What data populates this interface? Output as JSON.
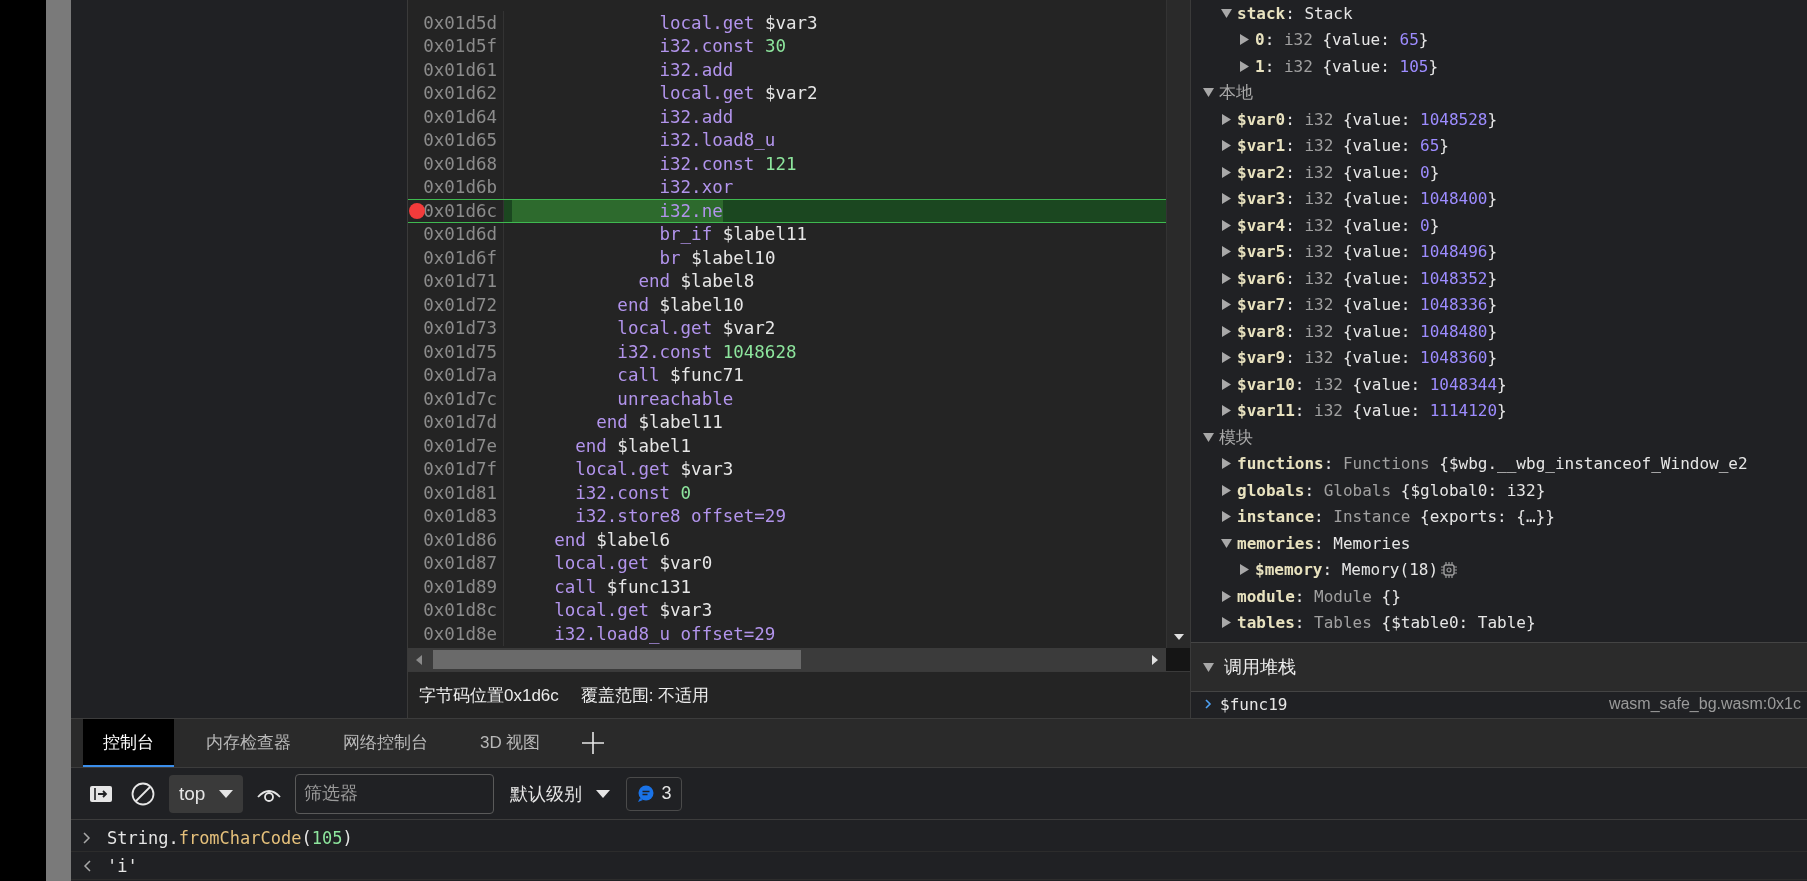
{
  "code_view": {
    "lines": [
      {
        "address": "0x01d5d",
        "breakpoint": false,
        "current": false,
        "segments": [
          {
            "text": "              local.get ",
            "kind": "op"
          },
          {
            "text": "$var3",
            "kind": "name"
          }
        ]
      },
      {
        "address": "0x01d5f",
        "breakpoint": false,
        "current": false,
        "segments": [
          {
            "text": "              i32.const ",
            "kind": "op"
          },
          {
            "text": "30",
            "kind": "literal"
          }
        ]
      },
      {
        "address": "0x01d61",
        "breakpoint": false,
        "current": false,
        "segments": [
          {
            "text": "              i32.add",
            "kind": "op"
          }
        ]
      },
      {
        "address": "0x01d62",
        "breakpoint": false,
        "current": false,
        "segments": [
          {
            "text": "              local.get ",
            "kind": "op"
          },
          {
            "text": "$var2",
            "kind": "name"
          }
        ]
      },
      {
        "address": "0x01d64",
        "breakpoint": false,
        "current": false,
        "segments": [
          {
            "text": "              i32.add",
            "kind": "op"
          }
        ]
      },
      {
        "address": "0x01d65",
        "breakpoint": false,
        "current": false,
        "segments": [
          {
            "text": "              i32.load8_u",
            "kind": "op"
          }
        ]
      },
      {
        "address": "0x01d68",
        "breakpoint": false,
        "current": false,
        "segments": [
          {
            "text": "              i32.const ",
            "kind": "op"
          },
          {
            "text": "121",
            "kind": "literal"
          }
        ]
      },
      {
        "address": "0x01d6b",
        "breakpoint": false,
        "current": false,
        "segments": [
          {
            "text": "              i32.xor",
            "kind": "op"
          }
        ]
      },
      {
        "address": "0x01d6c",
        "breakpoint": true,
        "current": true,
        "segments": [
          {
            "text": "              i32.ne",
            "kind": "op"
          }
        ]
      },
      {
        "address": "0x01d6d",
        "breakpoint": false,
        "current": false,
        "segments": [
          {
            "text": "              br_if ",
            "kind": "op"
          },
          {
            "text": "$label11",
            "kind": "name"
          }
        ]
      },
      {
        "address": "0x01d6f",
        "breakpoint": false,
        "current": false,
        "segments": [
          {
            "text": "              br ",
            "kind": "op"
          },
          {
            "text": "$label10",
            "kind": "name"
          }
        ]
      },
      {
        "address": "0x01d71",
        "breakpoint": false,
        "current": false,
        "segments": [
          {
            "text": "            end ",
            "kind": "op"
          },
          {
            "text": "$label8",
            "kind": "name"
          }
        ]
      },
      {
        "address": "0x01d72",
        "breakpoint": false,
        "current": false,
        "segments": [
          {
            "text": "          end ",
            "kind": "op"
          },
          {
            "text": "$label10",
            "kind": "name"
          }
        ]
      },
      {
        "address": "0x01d73",
        "breakpoint": false,
        "current": false,
        "segments": [
          {
            "text": "          local.get ",
            "kind": "op"
          },
          {
            "text": "$var2",
            "kind": "name"
          }
        ]
      },
      {
        "address": "0x01d75",
        "breakpoint": false,
        "current": false,
        "segments": [
          {
            "text": "          i32.const ",
            "kind": "op"
          },
          {
            "text": "1048628",
            "kind": "literal"
          }
        ]
      },
      {
        "address": "0x01d7a",
        "breakpoint": false,
        "current": false,
        "segments": [
          {
            "text": "          call ",
            "kind": "op"
          },
          {
            "text": "$func71",
            "kind": "name"
          }
        ]
      },
      {
        "address": "0x01d7c",
        "breakpoint": false,
        "current": false,
        "segments": [
          {
            "text": "          unreachable",
            "kind": "op"
          }
        ]
      },
      {
        "address": "0x01d7d",
        "breakpoint": false,
        "current": false,
        "segments": [
          {
            "text": "        end ",
            "kind": "op"
          },
          {
            "text": "$label11",
            "kind": "name"
          }
        ]
      },
      {
        "address": "0x01d7e",
        "breakpoint": false,
        "current": false,
        "segments": [
          {
            "text": "      end ",
            "kind": "op"
          },
          {
            "text": "$label1",
            "kind": "name"
          }
        ]
      },
      {
        "address": "0x01d7f",
        "breakpoint": false,
        "current": false,
        "segments": [
          {
            "text": "      local.get ",
            "kind": "op"
          },
          {
            "text": "$var3",
            "kind": "name"
          }
        ]
      },
      {
        "address": "0x01d81",
        "breakpoint": false,
        "current": false,
        "segments": [
          {
            "text": "      i32.const ",
            "kind": "op"
          },
          {
            "text": "0",
            "kind": "literal"
          }
        ]
      },
      {
        "address": "0x01d83",
        "breakpoint": false,
        "current": false,
        "segments": [
          {
            "text": "      i32.store8 offset=29",
            "kind": "op"
          }
        ]
      },
      {
        "address": "0x01d86",
        "breakpoint": false,
        "current": false,
        "segments": [
          {
            "text": "    end ",
            "kind": "op"
          },
          {
            "text": "$label6",
            "kind": "name"
          }
        ]
      },
      {
        "address": "0x01d87",
        "breakpoint": false,
        "current": false,
        "segments": [
          {
            "text": "    local.get ",
            "kind": "op"
          },
          {
            "text": "$var0",
            "kind": "name"
          }
        ]
      },
      {
        "address": "0x01d89",
        "breakpoint": false,
        "current": false,
        "segments": [
          {
            "text": "    call ",
            "kind": "op"
          },
          {
            "text": "$func131",
            "kind": "name"
          }
        ]
      },
      {
        "address": "0x01d8c",
        "breakpoint": false,
        "current": false,
        "segments": [
          {
            "text": "    local.get ",
            "kind": "op"
          },
          {
            "text": "$var3",
            "kind": "name"
          }
        ]
      },
      {
        "address": "0x01d8e",
        "breakpoint": false,
        "current": false,
        "segments": [
          {
            "text": "    i32.load8_u offset=29",
            "kind": "op"
          }
        ]
      }
    ]
  },
  "status_bar": {
    "position": "字节码位置0x1d6c",
    "coverage": "覆盖范围: 不适用"
  },
  "scope_tree": [
    {
      "kind": "property",
      "expanded": true,
      "segments": [
        {
          "text": "stack",
          "kind": "key"
        },
        {
          "text": ": ",
          "kind": "plain"
        },
        {
          "text": "Stack",
          "kind": "plain"
        }
      ],
      "children": [
        {
          "kind": "property",
          "expanded": false,
          "segments": [
            {
              "text": "0",
              "kind": "key"
            },
            {
              "text": ": ",
              "kind": "plain"
            },
            {
              "text": "i32",
              "kind": "type"
            },
            {
              "text": " {value: ",
              "kind": "plain"
            },
            {
              "text": "65",
              "kind": "number"
            },
            {
              "text": "}",
              "kind": "plain"
            }
          ]
        },
        {
          "kind": "property",
          "expanded": false,
          "segments": [
            {
              "text": "1",
              "kind": "key"
            },
            {
              "text": ": ",
              "kind": "plain"
            },
            {
              "text": "i32",
              "kind": "type"
            },
            {
              "text": " {value: ",
              "kind": "plain"
            },
            {
              "text": "105",
              "kind": "number"
            },
            {
              "text": "}",
              "kind": "plain"
            }
          ]
        }
      ]
    },
    {
      "kind": "section",
      "label": "本地",
      "expanded": true,
      "children": [
        {
          "kind": "property",
          "expanded": false,
          "segments": [
            {
              "text": "$var0",
              "kind": "key"
            },
            {
              "text": ": ",
              "kind": "plain"
            },
            {
              "text": "i32",
              "kind": "type"
            },
            {
              "text": " {value: ",
              "kind": "plain"
            },
            {
              "text": "1048528",
              "kind": "number"
            },
            {
              "text": "}",
              "kind": "plain"
            }
          ]
        },
        {
          "kind": "property",
          "expanded": false,
          "segments": [
            {
              "text": "$var1",
              "kind": "key"
            },
            {
              "text": ": ",
              "kind": "plain"
            },
            {
              "text": "i32",
              "kind": "type"
            },
            {
              "text": " {value: ",
              "kind": "plain"
            },
            {
              "text": "65",
              "kind": "number"
            },
            {
              "text": "}",
              "kind": "plain"
            }
          ]
        },
        {
          "kind": "property",
          "expanded": false,
          "segments": [
            {
              "text": "$var2",
              "kind": "key"
            },
            {
              "text": ": ",
              "kind": "plain"
            },
            {
              "text": "i32",
              "kind": "type"
            },
            {
              "text": " {value: ",
              "kind": "plain"
            },
            {
              "text": "0",
              "kind": "number"
            },
            {
              "text": "}",
              "kind": "plain"
            }
          ]
        },
        {
          "kind": "property",
          "expanded": false,
          "segments": [
            {
              "text": "$var3",
              "kind": "key"
            },
            {
              "text": ": ",
              "kind": "plain"
            },
            {
              "text": "i32",
              "kind": "type"
            },
            {
              "text": " {value: ",
              "kind": "plain"
            },
            {
              "text": "1048400",
              "kind": "number"
            },
            {
              "text": "}",
              "kind": "plain"
            }
          ]
        },
        {
          "kind": "property",
          "expanded": false,
          "segments": [
            {
              "text": "$var4",
              "kind": "key"
            },
            {
              "text": ": ",
              "kind": "plain"
            },
            {
              "text": "i32",
              "kind": "type"
            },
            {
              "text": " {value: ",
              "kind": "plain"
            },
            {
              "text": "0",
              "kind": "number"
            },
            {
              "text": "}",
              "kind": "plain"
            }
          ]
        },
        {
          "kind": "property",
          "expanded": false,
          "segments": [
            {
              "text": "$var5",
              "kind": "key"
            },
            {
              "text": ": ",
              "kind": "plain"
            },
            {
              "text": "i32",
              "kind": "type"
            },
            {
              "text": " {value: ",
              "kind": "plain"
            },
            {
              "text": "1048496",
              "kind": "number"
            },
            {
              "text": "}",
              "kind": "plain"
            }
          ]
        },
        {
          "kind": "property",
          "expanded": false,
          "segments": [
            {
              "text": "$var6",
              "kind": "key"
            },
            {
              "text": ": ",
              "kind": "plain"
            },
            {
              "text": "i32",
              "kind": "type"
            },
            {
              "text": " {value: ",
              "kind": "plain"
            },
            {
              "text": "1048352",
              "kind": "number"
            },
            {
              "text": "}",
              "kind": "plain"
            }
          ]
        },
        {
          "kind": "property",
          "expanded": false,
          "segments": [
            {
              "text": "$var7",
              "kind": "key"
            },
            {
              "text": ": ",
              "kind": "plain"
            },
            {
              "text": "i32",
              "kind": "type"
            },
            {
              "text": " {value: ",
              "kind": "plain"
            },
            {
              "text": "1048336",
              "kind": "number"
            },
            {
              "text": "}",
              "kind": "plain"
            }
          ]
        },
        {
          "kind": "property",
          "expanded": false,
          "segments": [
            {
              "text": "$var8",
              "kind": "key"
            },
            {
              "text": ": ",
              "kind": "plain"
            },
            {
              "text": "i32",
              "kind": "type"
            },
            {
              "text": " {value: ",
              "kind": "plain"
            },
            {
              "text": "1048480",
              "kind": "number"
            },
            {
              "text": "}",
              "kind": "plain"
            }
          ]
        },
        {
          "kind": "property",
          "expanded": false,
          "segments": [
            {
              "text": "$var9",
              "kind": "key"
            },
            {
              "text": ": ",
              "kind": "plain"
            },
            {
              "text": "i32",
              "kind": "type"
            },
            {
              "text": " {value: ",
              "kind": "plain"
            },
            {
              "text": "1048360",
              "kind": "number"
            },
            {
              "text": "}",
              "kind": "plain"
            }
          ]
        },
        {
          "kind": "property",
          "expanded": false,
          "segments": [
            {
              "text": "$var10",
              "kind": "key"
            },
            {
              "text": ": ",
              "kind": "plain"
            },
            {
              "text": "i32",
              "kind": "type"
            },
            {
              "text": " {value: ",
              "kind": "plain"
            },
            {
              "text": "1048344",
              "kind": "number"
            },
            {
              "text": "}",
              "kind": "plain"
            }
          ]
        },
        {
          "kind": "property",
          "expanded": false,
          "segments": [
            {
              "text": "$var11",
              "kind": "key"
            },
            {
              "text": ": ",
              "kind": "plain"
            },
            {
              "text": "i32",
              "kind": "type"
            },
            {
              "text": " {value: ",
              "kind": "plain"
            },
            {
              "text": "1114120",
              "kind": "number"
            },
            {
              "text": "}",
              "kind": "plain"
            }
          ]
        }
      ]
    },
    {
      "kind": "section",
      "label": "模块",
      "expanded": true,
      "children": [
        {
          "kind": "property",
          "expanded": false,
          "segments": [
            {
              "text": "functions",
              "kind": "key"
            },
            {
              "text": ": ",
              "kind": "plain"
            },
            {
              "text": "Functions",
              "kind": "type"
            },
            {
              "text": " {$wbg.__wbg_instanceof_Window_e2",
              "kind": "plain"
            }
          ]
        },
        {
          "kind": "property",
          "expanded": false,
          "segments": [
            {
              "text": "globals",
              "kind": "key"
            },
            {
              "text": ": ",
              "kind": "plain"
            },
            {
              "text": "Globals",
              "kind": "type"
            },
            {
              "text": " {$global0: i32}",
              "kind": "plain"
            }
          ]
        },
        {
          "kind": "property",
          "expanded": false,
          "segments": [
            {
              "text": "instance",
              "kind": "key"
            },
            {
              "text": ": ",
              "kind": "plain"
            },
            {
              "text": "Instance",
              "kind": "type"
            },
            {
              "text": " {exports: {…}}",
              "kind": "plain"
            }
          ]
        },
        {
          "kind": "property",
          "expanded": true,
          "segments": [
            {
              "text": "memories",
              "kind": "key"
            },
            {
              "text": ": ",
              "kind": "plain"
            },
            {
              "text": "Memories",
              "kind": "plain"
            }
          ],
          "children": [
            {
              "kind": "property",
              "expanded": false,
              "memory_inspector": true,
              "segments": [
                {
                  "text": "$memory",
                  "kind": "key"
                },
                {
                  "text": ": ",
                  "kind": "plain"
                },
                {
                  "text": "Memory(18)",
                  "kind": "plain"
                }
              ]
            }
          ]
        },
        {
          "kind": "property",
          "expanded": false,
          "segments": [
            {
              "text": "module",
              "kind": "key"
            },
            {
              "text": ": ",
              "kind": "plain"
            },
            {
              "text": "Module",
              "kind": "type"
            },
            {
              "text": " {}",
              "kind": "plain"
            }
          ]
        },
        {
          "kind": "property",
          "expanded": false,
          "segments": [
            {
              "text": "tables",
              "kind": "key"
            },
            {
              "text": ": ",
              "kind": "plain"
            },
            {
              "text": "Tables",
              "kind": "type"
            },
            {
              "text": " {$table0: Table}",
              "kind": "plain"
            }
          ]
        }
      ]
    }
  ],
  "call_stack": {
    "title": "调用堆栈",
    "expanded": true,
    "frames": [
      {
        "name": "$func19",
        "location": "wasm_safe_bg.wasm:0x1c",
        "current": true
      }
    ]
  },
  "drawer": {
    "tabs": [
      {
        "label": "控制台",
        "selected": true
      },
      {
        "label": "内存检查器",
        "selected": false
      },
      {
        "label": "网络控制台",
        "selected": false
      },
      {
        "label": "3D 视图",
        "selected": false
      }
    ],
    "toolbar": {
      "context": "top",
      "filter": {
        "placeholder": "筛选器"
      },
      "log_level": "默认级别",
      "message_count": "3"
    },
    "console": [
      {
        "kind": "input",
        "segments": [
          {
            "text": "String.",
            "kind": "plain"
          },
          {
            "text": "fromCharCode",
            "kind": "method"
          },
          {
            "text": "(",
            "kind": "plain"
          },
          {
            "text": "105",
            "kind": "literal"
          },
          {
            "text": ")",
            "kind": "plain"
          }
        ]
      },
      {
        "kind": "output",
        "segments": [
          {
            "text": "'i'",
            "kind": "plain"
          }
        ]
      }
    ]
  }
}
